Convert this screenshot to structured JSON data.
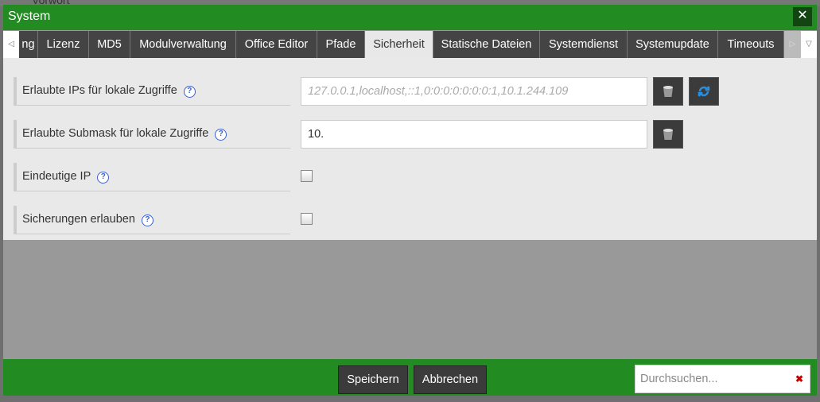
{
  "background": {
    "text": "Vorwort"
  },
  "dialog": {
    "title": "System",
    "close_icon": "close-icon"
  },
  "tabs": [
    {
      "label": "ng"
    },
    {
      "label": "Lizenz"
    },
    {
      "label": "MD5"
    },
    {
      "label": "Modulverwaltung"
    },
    {
      "label": "Office Editor"
    },
    {
      "label": "Pfade"
    },
    {
      "label": "Sicherheit",
      "active": true
    },
    {
      "label": "Statische Dateien"
    },
    {
      "label": "Systemdienst"
    },
    {
      "label": "Systemupdate"
    },
    {
      "label": "Timeouts"
    }
  ],
  "fields": [
    {
      "label": "Erlaubte IPs für lokale Zugriffe",
      "type": "text",
      "placeholder": "127.0.0.1,localhost,::1,0:0:0:0:0:0:0:1,10.1.244.109",
      "value": "",
      "buttons": [
        "trash-icon",
        "refresh-icon"
      ]
    },
    {
      "label": "Erlaubte Submask für lokale Zugriffe",
      "type": "text",
      "value": "10.",
      "buttons": [
        "trash-icon"
      ]
    },
    {
      "label": "Eindeutige IP",
      "type": "checkbox",
      "checked": false
    },
    {
      "label": "Sicherungen erlauben",
      "type": "checkbox",
      "checked": false
    }
  ],
  "help_glyph": "?",
  "footer": {
    "save": "Speichern",
    "cancel": "Abbrechen",
    "search_placeholder": "Durchsuchen...",
    "clear_glyph": "✖"
  },
  "colors": {
    "accent": "#228b22",
    "button": "#3b3b3b"
  }
}
